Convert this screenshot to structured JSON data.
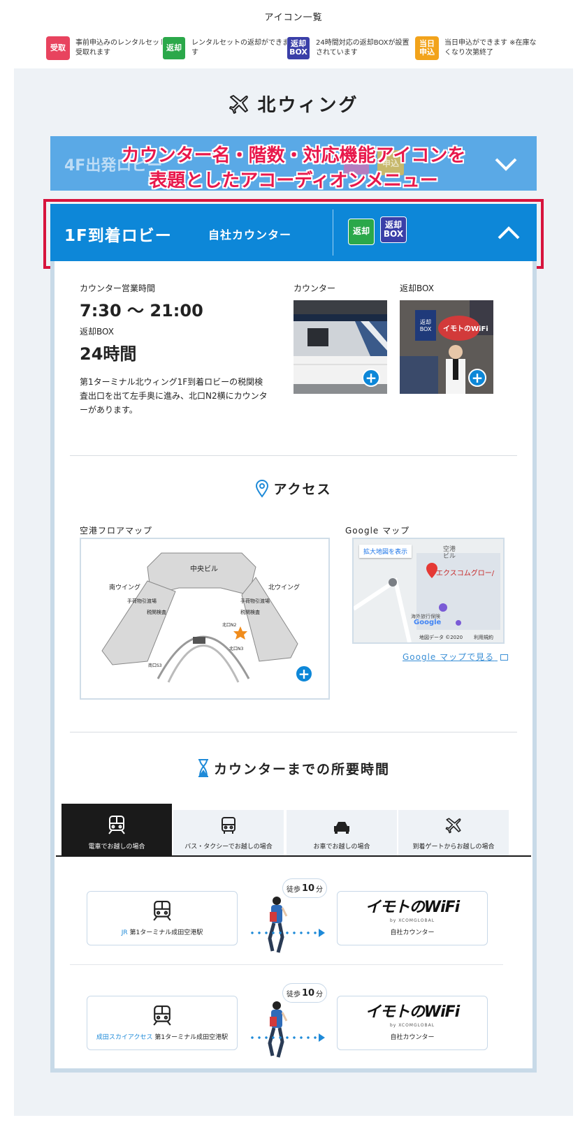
{
  "legend": {
    "title": "アイコン一覧",
    "items": [
      {
        "badge": "受取",
        "text": "事前申込みのレンタルセットを受取れます",
        "color": "#e8435e"
      },
      {
        "badge": "返却",
        "text": "レンタルセットの返却ができます",
        "color": "#2ba84a"
      },
      {
        "badge_line1": "返却",
        "badge_line2": "BOX",
        "text": "24時間対応の返却BOXが設置されています",
        "color": "#3a3fa8"
      },
      {
        "badge_line1": "当日",
        "badge_line2": "申込",
        "text": "当日申込ができます ※在庫なくなり次第終了",
        "color": "#f2a31b"
      }
    ]
  },
  "wing": {
    "title": "北ウィング",
    "icon": "airplane-icon"
  },
  "accordion_collapsed": {
    "title": "4F出発ロビー",
    "ghost_badge": "申込"
  },
  "annotation": {
    "line1": "カウンター名・階数・対応機能アイコンを",
    "line2": "表題としたアコーディオンメニュー"
  },
  "accordion_open": {
    "title": "1F到着ロビー",
    "subtitle": "自社カウンター",
    "badge1": "返却",
    "badge2_line1": "返却",
    "badge2_line2": "BOX"
  },
  "details": {
    "hours_label": "カウンター営業時間",
    "hours_value": "7:30 〜 21:00",
    "box_label": "返却BOX",
    "box_value": "24時間",
    "description": "第1ターミナル北ウィング1F到着ロビーの税関検査出口を出て左手奥に進み、北口N2横にカウンターがあります。",
    "photo1_label": "カウンター",
    "photo2_label": "返却BOX",
    "photo2_sign": "イモトのWiFi",
    "photo2_box": "返却 BOX"
  },
  "access": {
    "title": "アクセス",
    "floor_map_label": "空港フロアマップ",
    "google_map_label": "Google マップ",
    "google_map_link": "Google マップで見る",
    "map_labels": {
      "center": "中央ビル",
      "south": "南ウイング",
      "north": "北ウイング",
      "baggage_s": "手荷物引渡場",
      "baggage_n": "手荷物引渡場",
      "customs_s": "税関検査",
      "customs_n": "税関検査",
      "n2": "北口N2",
      "n3": "北口N3",
      "s3": "南口S3"
    },
    "gmap": {
      "enlarge": "拡大地図を表示",
      "place": "エクスコムグロー/",
      "airport": "空港 ビル",
      "travel": "海外旅行保険",
      "data": "地図データ ©2020",
      "terms": "利用規約",
      "brand": "Google"
    }
  },
  "duration": {
    "title": "カウンターまでの所要時間",
    "tabs": [
      {
        "label": "電車でお越しの場合",
        "icon": "train-icon"
      },
      {
        "label": "バス・タクシーでお越しの場合",
        "icon": "bus-icon"
      },
      {
        "label": "お車でお越しの場合",
        "icon": "car-icon"
      },
      {
        "label": "到着ゲートからお越しの場合",
        "icon": "airplane-icon"
      }
    ],
    "routes": [
      {
        "from_line": "JR",
        "from_station": "第1ターミナル成田空港駅",
        "walk_prefix": "徒歩",
        "walk_num": "10",
        "walk_unit": "分",
        "to_logo": "イモトのWiFi",
        "to_logo_sub": "by XCOMGLOBAL",
        "to_label": "自社カウンター"
      },
      {
        "from_line": "成田スカイアクセス",
        "from_station": "第1ターミナル成田空港駅",
        "walk_prefix": "徒歩",
        "walk_num": "10",
        "walk_unit": "分",
        "to_logo": "イモトのWiFi",
        "to_logo_sub": "by XCOMGLOBAL",
        "to_label": "自社カウンター"
      }
    ]
  }
}
